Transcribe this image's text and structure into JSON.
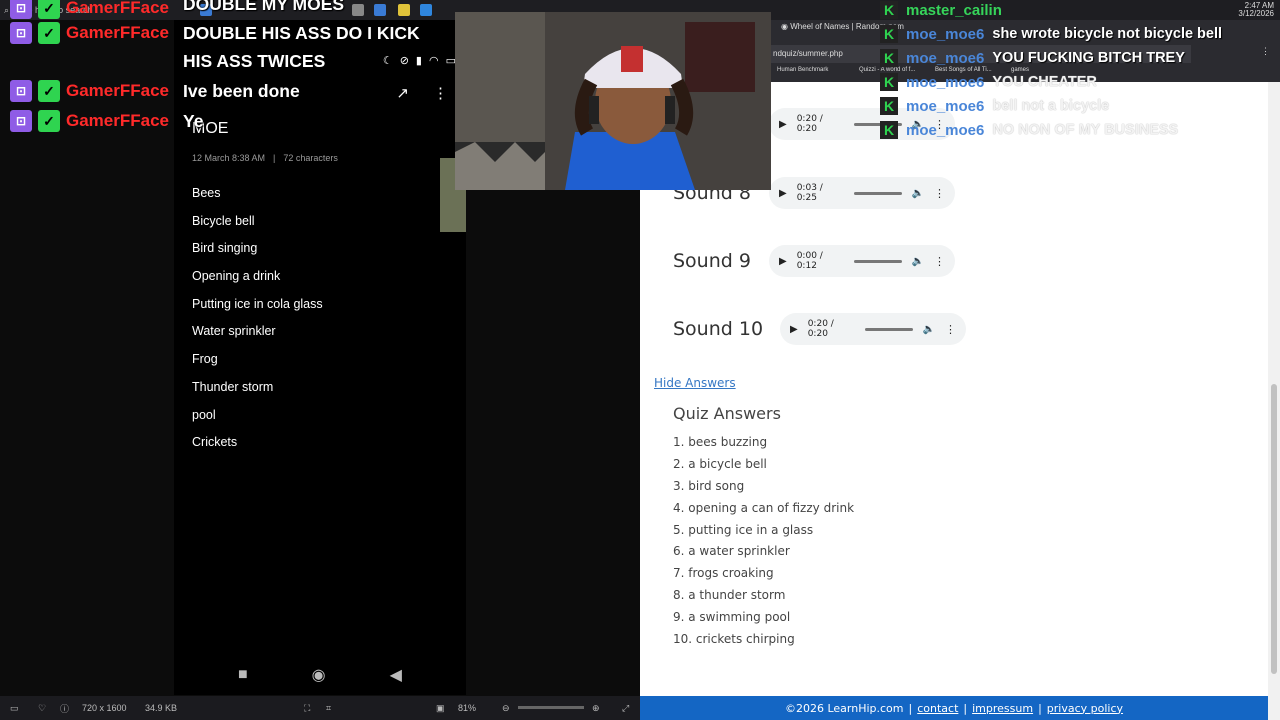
{
  "os": {
    "search_placeholder": "Type here to search",
    "clock_time": "2:47 AM",
    "clock_date": "3/12/2026"
  },
  "left_chat": [
    {
      "name": "GamerFFace"
    },
    {
      "name": "GamerFFace"
    },
    {
      "name": "GamerFFace"
    },
    {
      "name": "GamerFFace"
    }
  ],
  "overlay_messages": {
    "line1": "DOUBLE MY MOES",
    "line2": "DOUBLE HIS ASS DO I KICK",
    "line3": "HIS ASS TWICES",
    "line4": "Ive been done",
    "line5": "Ye"
  },
  "phone": {
    "note_title": "MOE",
    "date": "12 March  8:38 AM",
    "separator": "|",
    "chars": "72 characters",
    "items": [
      "Bees",
      "Bicycle bell",
      "Bird singing",
      "Opening a drink",
      "Putting ice in cola glass",
      "Water sprinkler",
      "Frog",
      "Thunder storm",
      "pool",
      "Crickets"
    ]
  },
  "viewer_bar": {
    "dims": "720 x 1600",
    "size": "34.9 KB",
    "zoom": "81%"
  },
  "browser": {
    "tab_title": "Wheel of Names | Random nam",
    "url": "ndquiz/summer.php",
    "bookmarks": [
      "Human Benchmark",
      "Quizzi - A world of f...",
      "Best Songs of All Ti...",
      "games"
    ]
  },
  "sounds": [
    {
      "label": "",
      "time": "0:20 / 0:20"
    },
    {
      "label": "Sound 8",
      "time": "0:03 / 0:25"
    },
    {
      "label": "Sound 9",
      "time": "0:00 / 0:12"
    },
    {
      "label": "Sound 10",
      "time": "0:20 / 0:20"
    }
  ],
  "quiz": {
    "hide_link": "Hide Answers",
    "title": "Quiz Answers",
    "answers": [
      "1. bees buzzing",
      "2. a bicycle bell",
      "3. bird song",
      "4. opening a can of fizzy drink",
      "5. putting ice in a glass",
      "6. a water sprinkler",
      "7. frogs croaking",
      "8. a thunder storm",
      "9. a swimming pool",
      "10. crickets chirping"
    ]
  },
  "footer": {
    "copyright": "©2026 LearnHip.com",
    "sep": "|",
    "links": [
      "contact",
      "impressum",
      "privacy policy"
    ]
  },
  "right_chat": [
    {
      "user": "master_cailin",
      "message": ""
    },
    {
      "user": "moe_moe6",
      "message": "she wrote bicycle not bicycle bell"
    },
    {
      "user": "moe_moe6",
      "message": "YOU FUCKING BITCH TREY"
    },
    {
      "user": "moe_moe6",
      "message": "YOU CHEATER"
    },
    {
      "user": "moe_moe6",
      "message": "bell not a bicycle"
    },
    {
      "user": "moe_moe6",
      "message": "NO NON OF MY BUSINESS"
    }
  ],
  "colors": {
    "twitch_purple": "#8f5ce6",
    "kick_green": "#2fd450",
    "gamer_red": "#ff2a2a",
    "link_blue": "#3577c4",
    "footer_blue": "#1466c4"
  }
}
